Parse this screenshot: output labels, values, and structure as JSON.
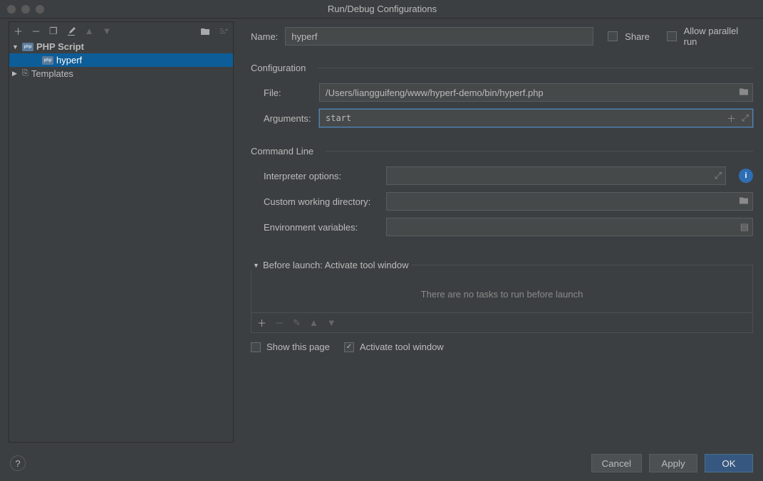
{
  "window": {
    "title": "Run/Debug Configurations"
  },
  "sidebar": {
    "php_script": "PHP Script",
    "hyperf": "hyperf",
    "templates": "Templates"
  },
  "header": {
    "name_label": "Name:",
    "name_value": "hyperf",
    "share_label": "Share",
    "allow_parallel_label": "Allow parallel run"
  },
  "config": {
    "section": "Configuration",
    "file_label": "File:",
    "file_value": "/Users/liangguifeng/www/hyperf-demo/bin/hyperf.php",
    "args_label": "Arguments:",
    "args_value": "start"
  },
  "cmdline": {
    "section": "Command Line",
    "interp_label": "Interpreter options:",
    "interp_value": "",
    "cwd_label": "Custom working directory:",
    "cwd_value": "",
    "env_label": "Environment variables:",
    "env_value": ""
  },
  "before_launch": {
    "section": "Before launch: Activate tool window",
    "empty_text": "There are no tasks to run before launch",
    "show_page_label": "Show this page",
    "activate_label": "Activate tool window"
  },
  "footer": {
    "cancel": "Cancel",
    "apply": "Apply",
    "ok": "OK"
  }
}
